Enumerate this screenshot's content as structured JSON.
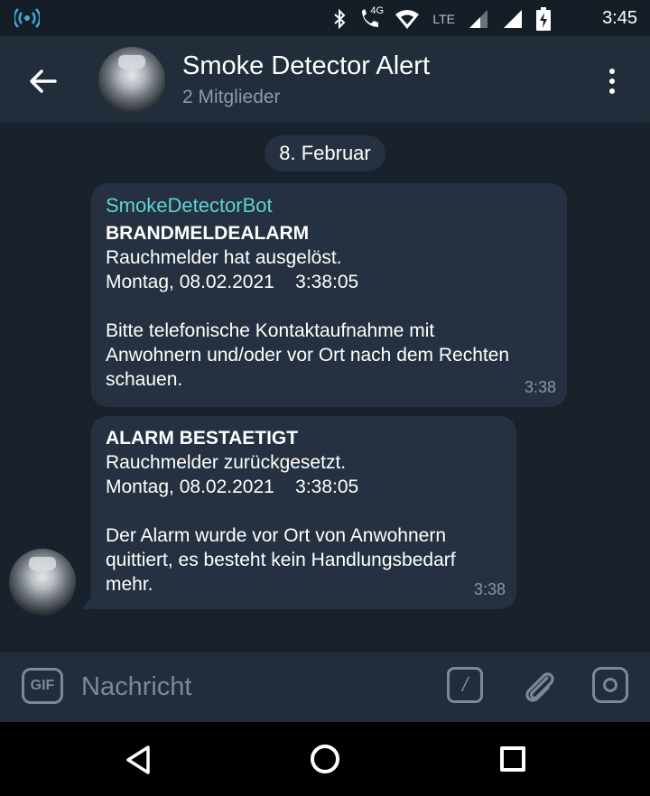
{
  "status_bar": {
    "time": "3:45",
    "network_label": "4G",
    "lte_label": "LTE"
  },
  "header": {
    "title": "Smoke Detector Alert",
    "subtitle": "2 Mitglieder"
  },
  "date_separator": "8. Februar",
  "messages": [
    {
      "sender": "SmokeDetectorBot",
      "lines": [
        "BRANDMELDEALARM",
        "Rauchmelder hat ausgelöst.",
        "Montag, 08.02.2021    3:38:05",
        "",
        "Bitte telefonische Kontaktaufnahme mit",
        "Anwohnern und/oder vor Ort nach dem Rechten",
        "schauen."
      ],
      "time": "3:38"
    },
    {
      "lines": [
        "ALARM BESTAETIGT",
        "Rauchmelder zurückgesetzt.",
        "Montag, 08.02.2021    3:38:05",
        "",
        "Der Alarm wurde vor Ort von Anwohnern",
        "quittiert, es besteht kein Handlungsbedarf",
        "mehr."
      ],
      "time": "3:38"
    }
  ],
  "composer": {
    "gif_label": "GIF",
    "placeholder": "Nachricht",
    "command_label": "/"
  },
  "colors": {
    "background": "#18212c",
    "header": "#212d3b",
    "bubble": "#253140",
    "sender_accent": "#5fd3cf",
    "secondary_text": "#8d99a6"
  },
  "icons": {
    "status_left": "broadcast-icon",
    "bluetooth": "bluetooth-icon",
    "call": "wifi-calling-icon",
    "wifi": "wifi-icon",
    "signal": "signal-icon",
    "battery": "battery-charging-icon",
    "back": "arrow-left-icon",
    "menu": "more-vertical-icon",
    "attach": "paperclip-icon",
    "camera": "camera-icon",
    "nav_back": "triangle-back-icon",
    "nav_home": "circle-home-icon",
    "nav_recent": "square-recent-icon"
  }
}
